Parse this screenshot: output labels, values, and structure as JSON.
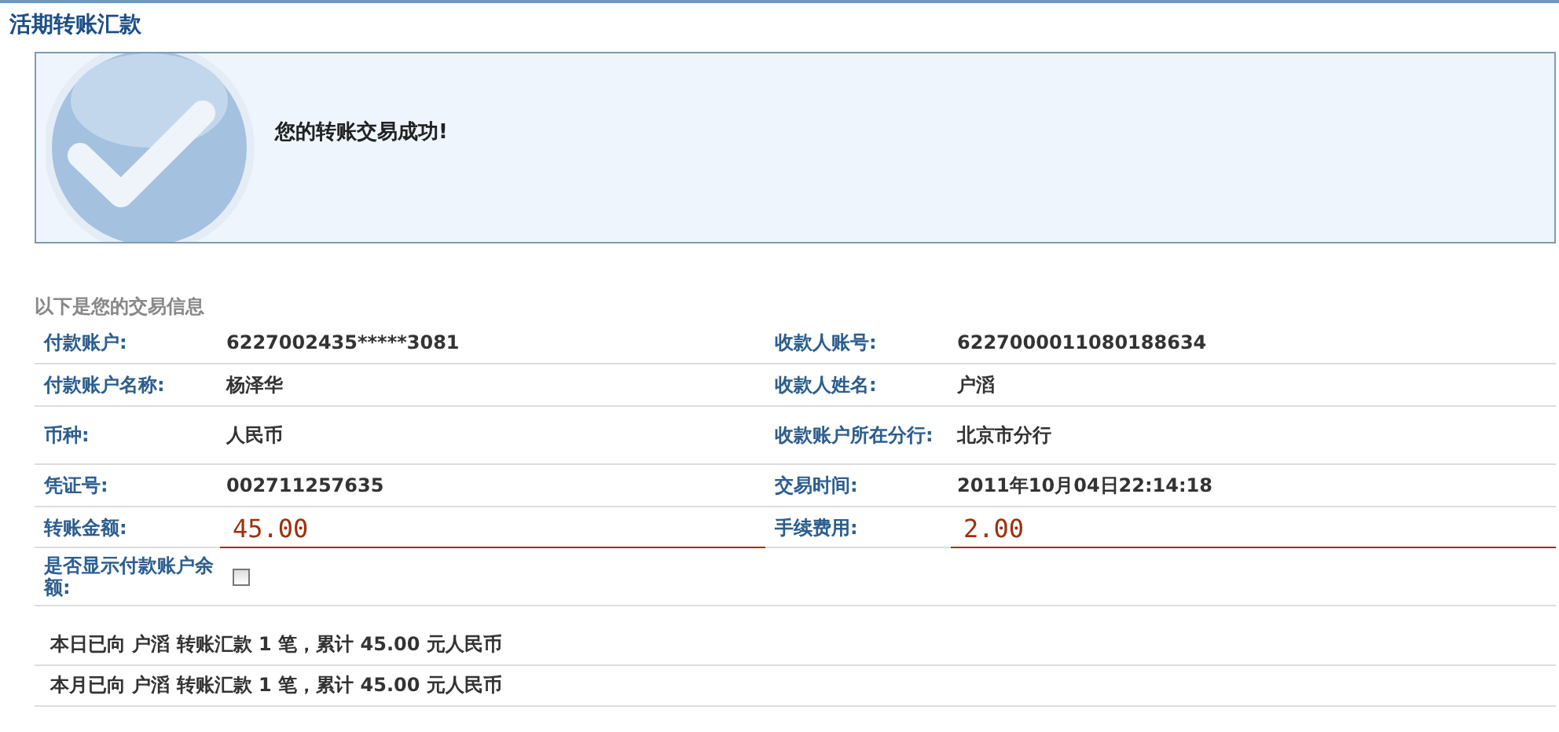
{
  "title": "活期转账汇款",
  "success": {
    "message": "您的转账交易成功!"
  },
  "info_caption": "以下是您的交易信息",
  "rows": [
    {
      "cells": [
        {
          "kind": "text",
          "label": "付款账户:",
          "value": "6227002435*****3081"
        },
        {
          "kind": "text",
          "label": "收款人账号:",
          "value": "6227000011080188634"
        }
      ]
    },
    {
      "cells": [
        {
          "kind": "text",
          "label": "付款账户名称:",
          "value": "杨泽华"
        },
        {
          "kind": "text",
          "label": "收款人姓名:",
          "value": "户滔"
        }
      ]
    },
    {
      "cells": [
        {
          "kind": "text",
          "label": "币种:",
          "value": "人民币"
        },
        {
          "kind": "text",
          "label": "收款账户所在分行:",
          "value": "北京市分行"
        }
      ]
    },
    {
      "cells": [
        {
          "kind": "text",
          "label": "凭证号:",
          "value": "002711257635"
        },
        {
          "kind": "text",
          "label": "交易时间:",
          "value": "2011年10月04日22:14:18"
        }
      ]
    },
    {
      "cells": [
        {
          "kind": "amount",
          "label": "转账金额:",
          "value": "45.00"
        },
        {
          "kind": "amount",
          "label": "手续费用:",
          "value": "2.00"
        }
      ]
    },
    {
      "cells": [
        {
          "kind": "checkbox",
          "label": "是否显示付款账户余额:",
          "checked": false
        }
      ]
    }
  ],
  "summary": [
    "本日已向 户滔 转账汇款 1 笔，累计 45.00 元人民币",
    "本月已向 户滔 转账汇款 1 笔，累计 45.00 元人民币"
  ]
}
